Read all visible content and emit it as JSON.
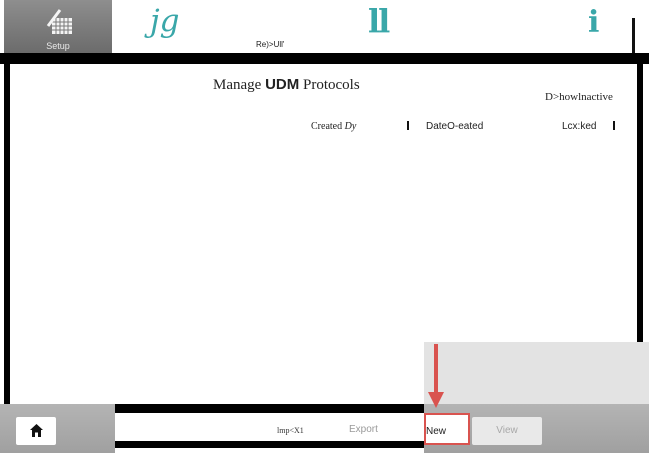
{
  "top": {
    "setup_label": "Setup",
    "glyph_1": "jg",
    "glyph_2": "ll",
    "glyph_3": "i",
    "report_label": "Re)>Ull'"
  },
  "main": {
    "title_prefix": "Manage",
    "title_bold": "UDM",
    "title_suffix": "Protocols",
    "show_inactive": "D>howlnactive",
    "columns": {
      "created_prefix": "Created",
      "created_suffix": "Dy",
      "date": "DateO-eated",
      "locked": "Lcx:ked"
    }
  },
  "bottom": {
    "import_label": "lmp<X1",
    "export_label": "Export",
    "new_label": "New",
    "view_label": "View"
  },
  "colors": {
    "accent": "#3aa7a9",
    "highlight": "#d9534f"
  }
}
